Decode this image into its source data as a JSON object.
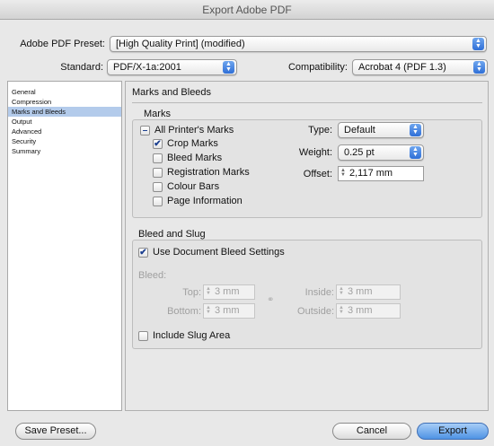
{
  "window": {
    "title": "Export Adobe PDF"
  },
  "preset": {
    "label": "Adobe PDF Preset:",
    "value": "[High Quality Print] (modified)"
  },
  "standard": {
    "label": "Standard:",
    "value": "PDF/X-1a:2001"
  },
  "compatibility": {
    "label": "Compatibility:",
    "value": "Acrobat 4 (PDF 1.3)"
  },
  "sidebar": {
    "items": [
      {
        "label": "General",
        "selected": false
      },
      {
        "label": "Compression",
        "selected": false
      },
      {
        "label": "Marks and Bleeds",
        "selected": true
      },
      {
        "label": "Output",
        "selected": false
      },
      {
        "label": "Advanced",
        "selected": false
      },
      {
        "label": "Security",
        "selected": false
      },
      {
        "label": "Summary",
        "selected": false
      }
    ]
  },
  "main": {
    "title": "Marks and Bleeds"
  },
  "marks": {
    "group_label": "Marks",
    "all_printers_marks": {
      "label": "All Printer's Marks",
      "state": "mixed"
    },
    "crop_marks": {
      "label": "Crop Marks",
      "checked": true
    },
    "bleed_marks": {
      "label": "Bleed Marks",
      "checked": false
    },
    "registration_marks": {
      "label": "Registration Marks",
      "checked": false
    },
    "colour_bars": {
      "label": "Colour Bars",
      "checked": false
    },
    "page_information": {
      "label": "Page Information",
      "checked": false
    },
    "type": {
      "label": "Type:",
      "value": "Default"
    },
    "weight": {
      "label": "Weight:",
      "value": "0.25 pt"
    },
    "offset": {
      "label": "Offset:",
      "value": "2,117 mm"
    }
  },
  "bleed_slug": {
    "group_label": "Bleed and Slug",
    "use_document_bleed": {
      "label": "Use Document Bleed Settings",
      "checked": true
    },
    "bleed_label": "Bleed:",
    "top": {
      "label": "Top:",
      "value": "3 mm"
    },
    "bottom": {
      "label": "Bottom:",
      "value": "3 mm"
    },
    "inside": {
      "label": "Inside:",
      "value": "3 mm"
    },
    "outside": {
      "label": "Outside:",
      "value": "3 mm"
    },
    "include_slug": {
      "label": "Include Slug Area",
      "checked": false
    }
  },
  "footer": {
    "save_preset": "Save Preset...",
    "cancel": "Cancel",
    "export": "Export"
  }
}
